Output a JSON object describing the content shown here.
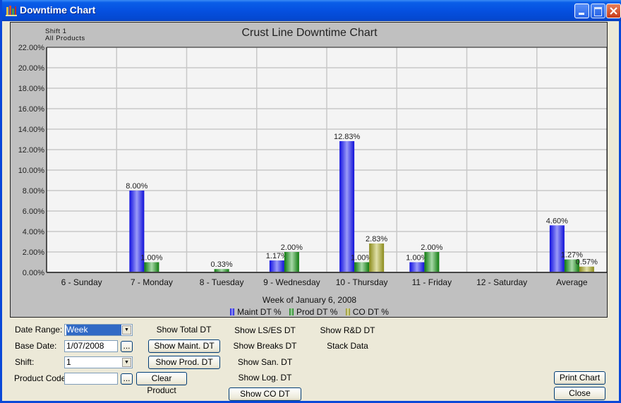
{
  "window": {
    "title": "Downtime Chart",
    "icon": "bar-chart-icon",
    "controls": [
      "minimize-icon",
      "maximize-icon",
      "close-icon"
    ]
  },
  "chart_header": {
    "shift_label": "Shift 1",
    "products_label": "All Products"
  },
  "chart_data": {
    "type": "bar",
    "title": "Crust Line Downtime Chart",
    "xlabel": "Week of January  6, 2008",
    "ylabel": "",
    "ylim": [
      0,
      22
    ],
    "y_ticks": [
      "0.00%",
      "2.00%",
      "4.00%",
      "6.00%",
      "8.00%",
      "10.00%",
      "12.00%",
      "14.00%",
      "16.00%",
      "18.00%",
      "20.00%",
      "22.00%"
    ],
    "y_tick_values": [
      0,
      2,
      4,
      6,
      8,
      10,
      12,
      14,
      16,
      18,
      20,
      22
    ],
    "grid": true,
    "legend_position": "bottom",
    "categories": [
      "6 - Sunday",
      "7 - Monday",
      "8 - Tuesday",
      "9 - Wednesday",
      "10 - Thursday",
      "11 - Friday",
      "12 - Saturday",
      "Average"
    ],
    "series": [
      {
        "name": "Maint DT %",
        "color": "#2a2af0",
        "values": [
          0,
          8.0,
          0,
          1.17,
          12.83,
          1.0,
          0,
          4.6
        ],
        "labels": [
          "",
          "8.00%",
          "",
          "1.17%",
          "12.83%",
          "1.00%",
          "",
          "4.60%"
        ]
      },
      {
        "name": "Prod DT %",
        "color": "#1e8a1e",
        "values": [
          0,
          1.0,
          0.33,
          2.0,
          1.0,
          2.0,
          0,
          1.27
        ],
        "labels": [
          "",
          "1.00%",
          "0.33%",
          "2.00%",
          "1.00%",
          "2.00%",
          "",
          "1.27%"
        ]
      },
      {
        "name": "CO DT %",
        "color": "#9a9a2a",
        "values": [
          0,
          0,
          0,
          0,
          2.83,
          0,
          0,
          0.57
        ],
        "labels": [
          "",
          "",
          "",
          "",
          "2.83%",
          "",
          "",
          "0.57%"
        ]
      }
    ]
  },
  "controls": {
    "date_range_label": "Date Range:",
    "date_range_value": "Week",
    "base_date_label": "Base Date:",
    "base_date_value": "1/07/2008",
    "shift_label": "Shift:",
    "shift_value": "1",
    "product_code_label": "Product Code:",
    "product_code_value": "",
    "ellipsis": "...",
    "clear_product": "Clear Product"
  },
  "toggles": {
    "show_total_dt": "Show Total DT",
    "show_maint_dt": "Show Maint. DT",
    "show_prod_dt": "Show Prod. DT",
    "show_lses_dt": "Show LS/ES DT",
    "show_breaks_dt": "Show Breaks DT",
    "show_san_dt": "Show San. DT",
    "show_log_dt": "Show Log. DT",
    "show_co_dt": "Show CO DT",
    "show_rd_dt": "Show R&D DT",
    "stack_data": "Stack Data"
  },
  "actions": {
    "print_chart": "Print Chart",
    "close": "Close"
  }
}
